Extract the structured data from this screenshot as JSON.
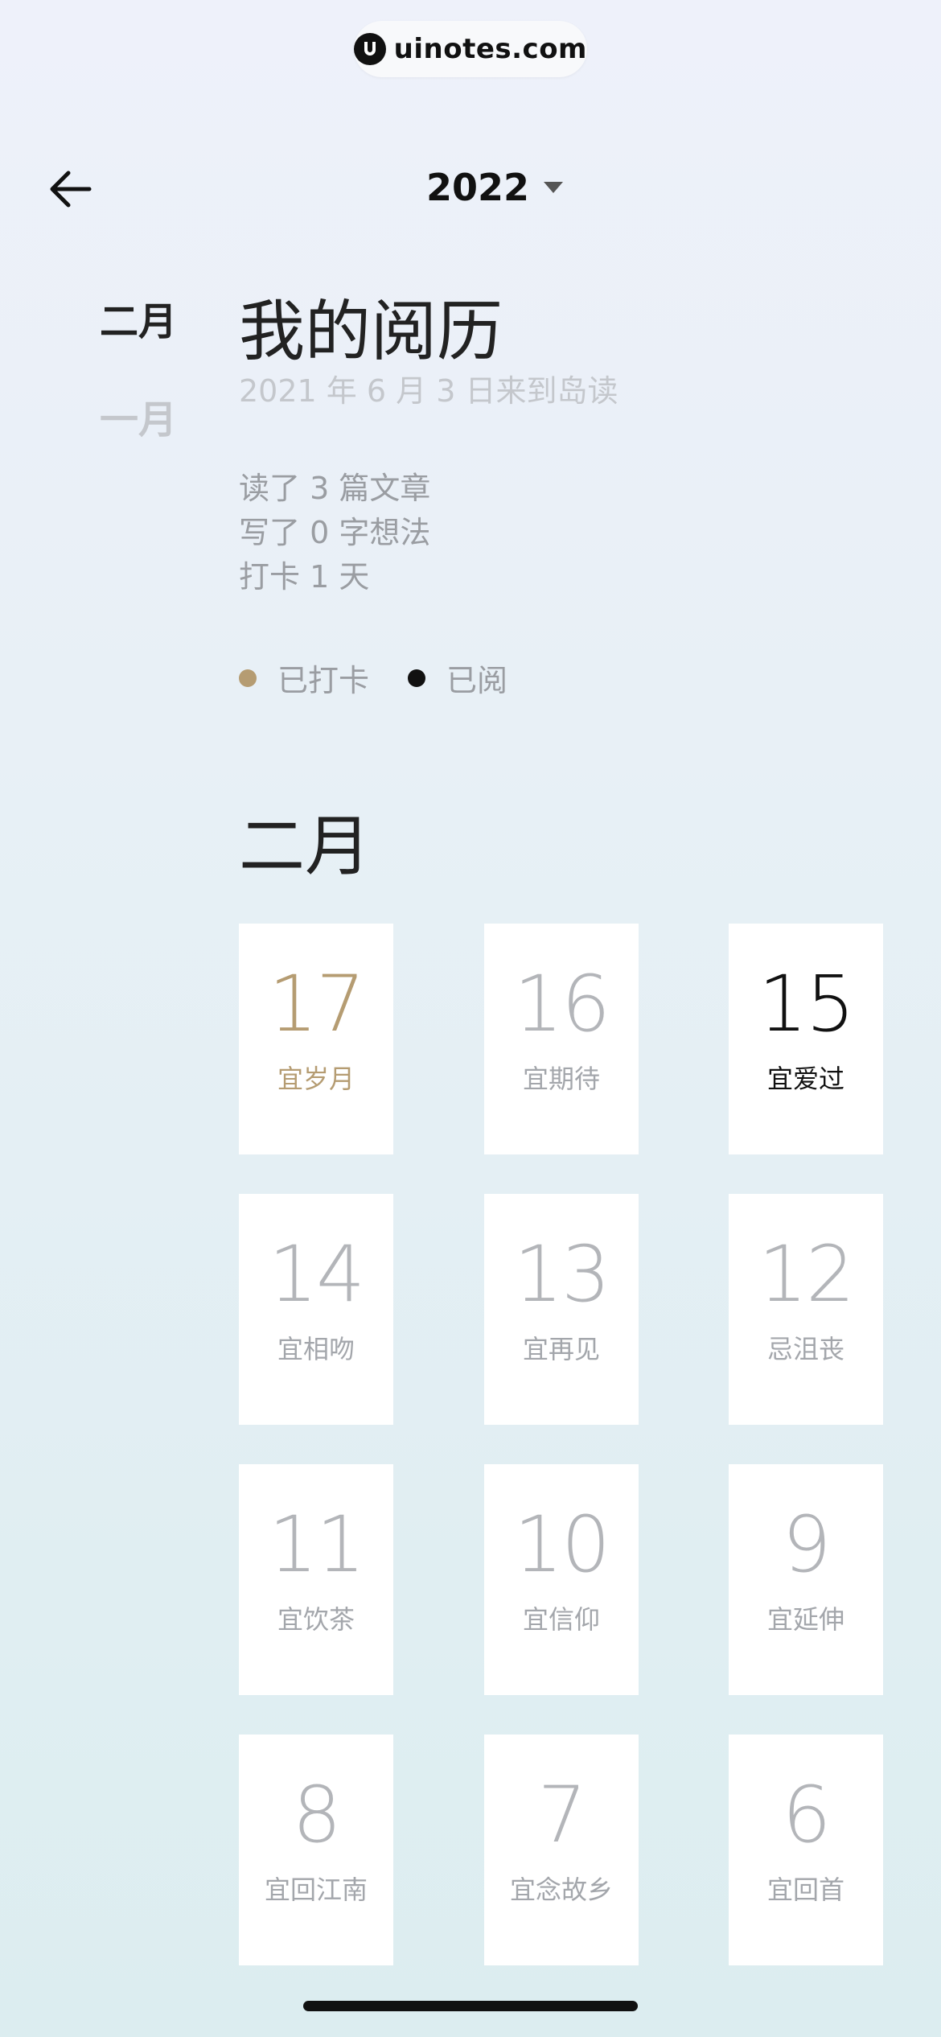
{
  "watermark": {
    "text": "uinotes.com"
  },
  "header": {
    "year": "2022"
  },
  "months_nav": [
    {
      "label": "二月",
      "active": true
    },
    {
      "label": "一月",
      "active": false
    }
  ],
  "page": {
    "title": "我的阅历",
    "since": "2021 年 6 月 3 日来到岛读",
    "stats": [
      "读了 3 篇文章",
      "写了 0 字想法",
      "打卡 1 天"
    ]
  },
  "legend": [
    {
      "label": "已打卡",
      "color": "#b59c72"
    },
    {
      "label": "已阅",
      "color": "#111111"
    }
  ],
  "section": {
    "title": "二月"
  },
  "days": [
    {
      "day": "17",
      "label": "宜岁月",
      "status": "checked-in"
    },
    {
      "day": "16",
      "label": "宜期待",
      "status": "none"
    },
    {
      "day": "15",
      "label": "宜爱过",
      "status": "read"
    },
    {
      "day": "14",
      "label": "宜相吻",
      "status": "none"
    },
    {
      "day": "13",
      "label": "宜再见",
      "status": "none"
    },
    {
      "day": "12",
      "label": "忌沮丧",
      "status": "none"
    },
    {
      "day": "11",
      "label": "宜饮茶",
      "status": "none"
    },
    {
      "day": "10",
      "label": "宜信仰",
      "status": "none"
    },
    {
      "day": "9",
      "label": "宜延伸",
      "status": "none"
    },
    {
      "day": "8",
      "label": "宜回江南",
      "status": "none"
    },
    {
      "day": "7",
      "label": "宜念故乡",
      "status": "none"
    },
    {
      "day": "6",
      "label": "宜回首",
      "status": "none"
    }
  ]
}
